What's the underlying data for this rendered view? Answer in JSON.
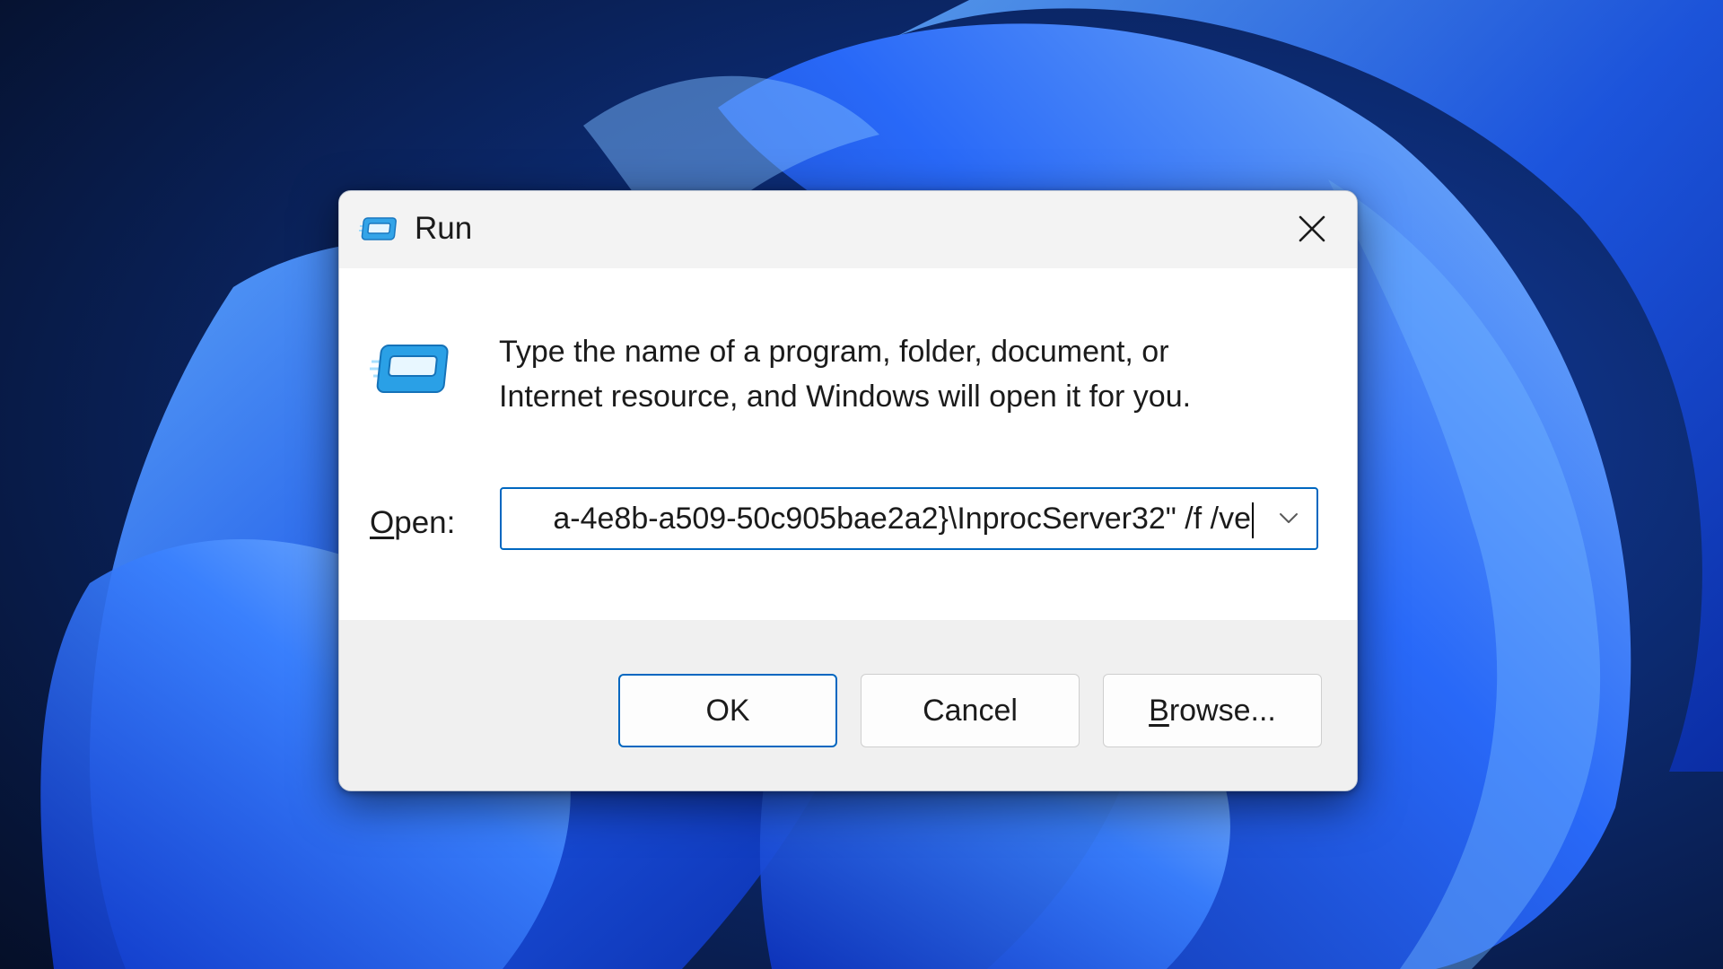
{
  "dialog": {
    "title": "Run",
    "description_line1": "Type the name of a program, folder, document, or",
    "description_line2": "Internet resource, and Windows will open it for you.",
    "open_label_mnemonic": "O",
    "open_label_rest": "pen:",
    "open_value": "a-4e8b-a509-50c905bae2a2}\\InprocServer32\" /f /ve",
    "buttons": {
      "ok": "OK",
      "cancel": "Cancel",
      "browse_mnemonic": "B",
      "browse_rest": "rowse..."
    }
  },
  "icons": {
    "title": "run-app-icon",
    "content": "run-app-icon",
    "close": "close-icon",
    "dropdown": "chevron-down-icon"
  },
  "colors": {
    "accent": "#0067c0",
    "dialog_bg": "#f3f3f3",
    "content_bg": "#ffffff",
    "wallpaper_dark": "#071a3e",
    "wallpaper_blue": "#1f5cf0"
  }
}
